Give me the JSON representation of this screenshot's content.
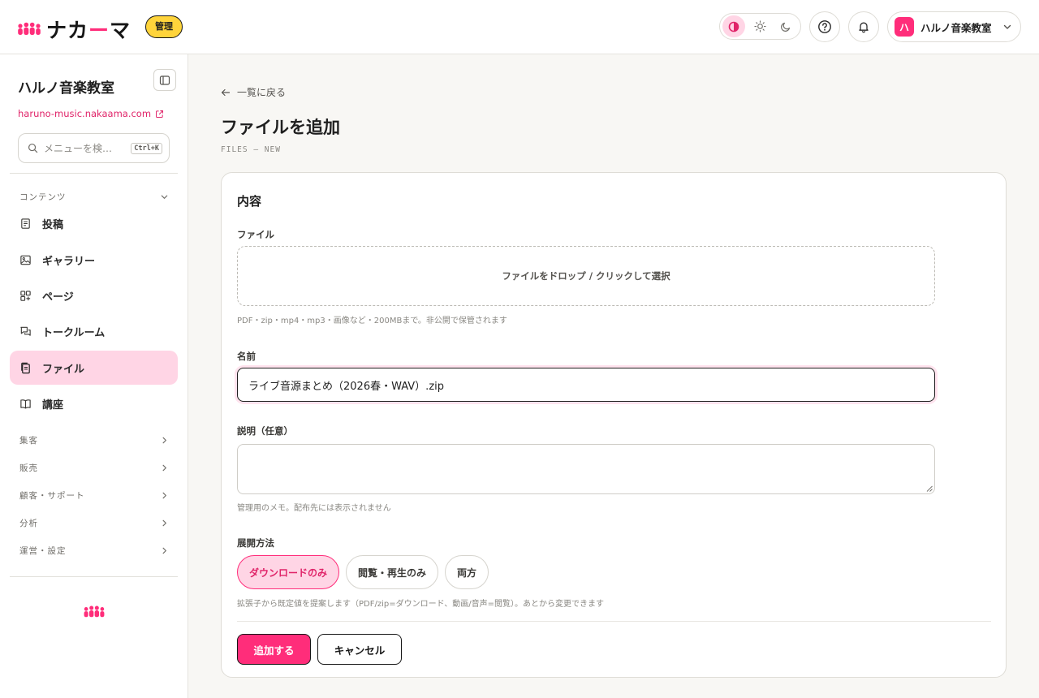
{
  "header": {
    "logo_text_a": "ナカ",
    "logo_text_b": "ー",
    "logo_text_c": "マ",
    "admin_badge": "管理",
    "account_avatar": "ハ",
    "account_name": "ハルノ音楽教室"
  },
  "sidebar": {
    "title": "ハルノ音楽教室",
    "site_url": "haruno-music.nakaama.com",
    "search_placeholder": "メニューを検…",
    "search_shortcut": "Ctrl+K",
    "contents_section": "コンテンツ",
    "items": [
      {
        "label": "投稿",
        "icon": "document-icon"
      },
      {
        "label": "ギャラリー",
        "icon": "image-icon"
      },
      {
        "label": "ページ",
        "icon": "pages-icon"
      },
      {
        "label": "トークルーム",
        "icon": "chat-icon"
      },
      {
        "label": "ファイル",
        "icon": "files-icon",
        "active": true
      },
      {
        "label": "講座",
        "icon": "book-icon"
      }
    ],
    "groups": [
      "集客",
      "販売",
      "顧客・サポート",
      "分析",
      "運営・設定"
    ]
  },
  "main": {
    "back_link": "一覧に戻る",
    "title": "ファイルを追加",
    "subtitle": "FILES — NEW",
    "card_title": "内容",
    "file_label": "ファイル",
    "dropzone_text": "ファイルをドロップ / クリックして選択",
    "file_hint": "PDF・zip・mp4・mp3・画像など・200MBまで。非公開で保管されます",
    "name_label": "名前",
    "name_value": "ライブ音源まとめ（2026春・WAV）.zip",
    "desc_label": "説明（任意）",
    "desc_value": "",
    "desc_hint": "管理用のメモ。配布先には表示されません",
    "mode_label": "展開方法",
    "modes": [
      {
        "label": "ダウンロードのみ",
        "selected": true
      },
      {
        "label": "閲覧・再生のみ",
        "selected": false
      },
      {
        "label": "両方",
        "selected": false
      }
    ],
    "mode_hint": "拡張子から既定値を提案します（PDF/zip=ダウンロード、動画/音声=閲覧）。あとから変更できます",
    "submit_label": "追加する",
    "cancel_label": "キャンセル"
  },
  "colors": {
    "accent": "#ff2d7a",
    "accent_light": "#ffd5e5",
    "badge": "#ffd43b"
  }
}
